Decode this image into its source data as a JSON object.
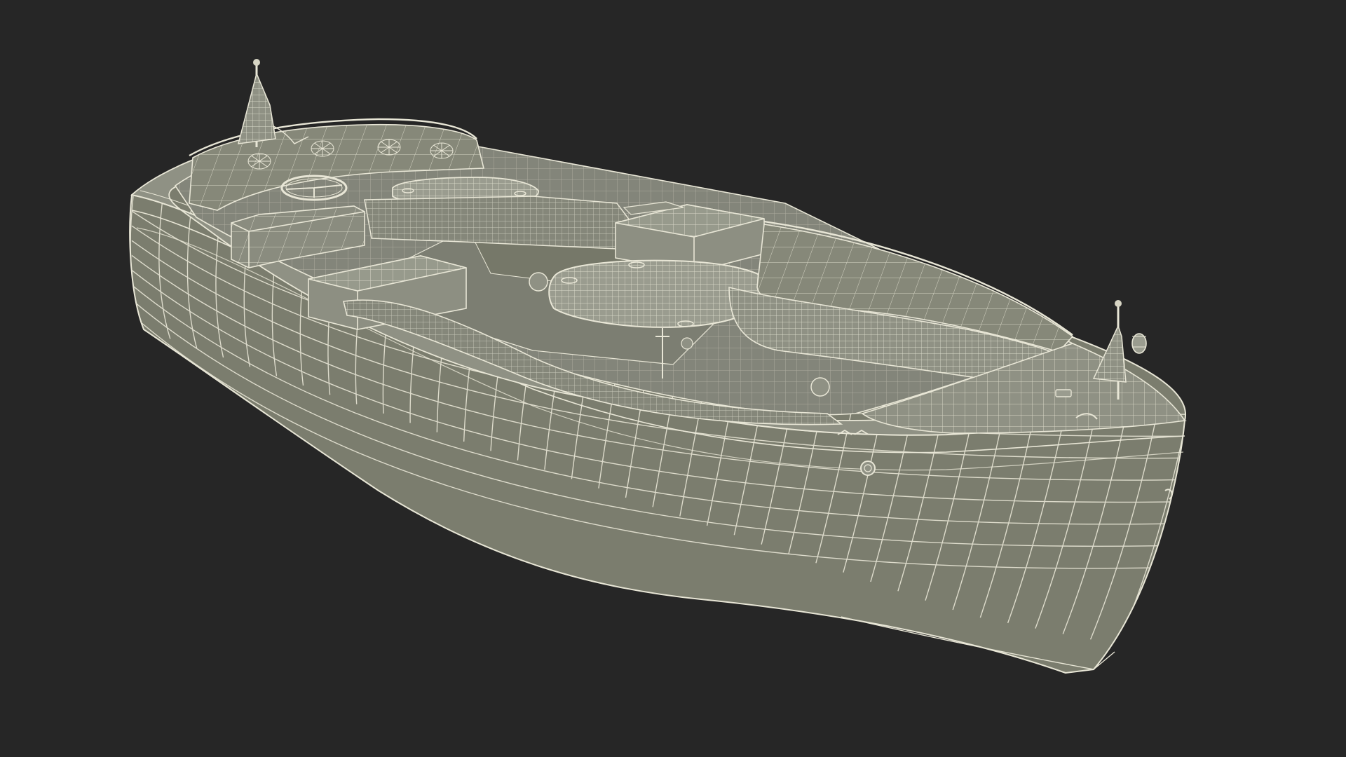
{
  "scene": {
    "subject": "boat-wireframe-render",
    "colors": {
      "background": "#262626",
      "hull_fill": "#7b7d6e",
      "hull_shadow": "#6d6f61",
      "interior_fill": "#83857a",
      "deck_fill": "#8f9184",
      "seat_fill": "#868879",
      "wire": "#e8e6d6",
      "wire_faint": "#d7d5c4"
    }
  }
}
